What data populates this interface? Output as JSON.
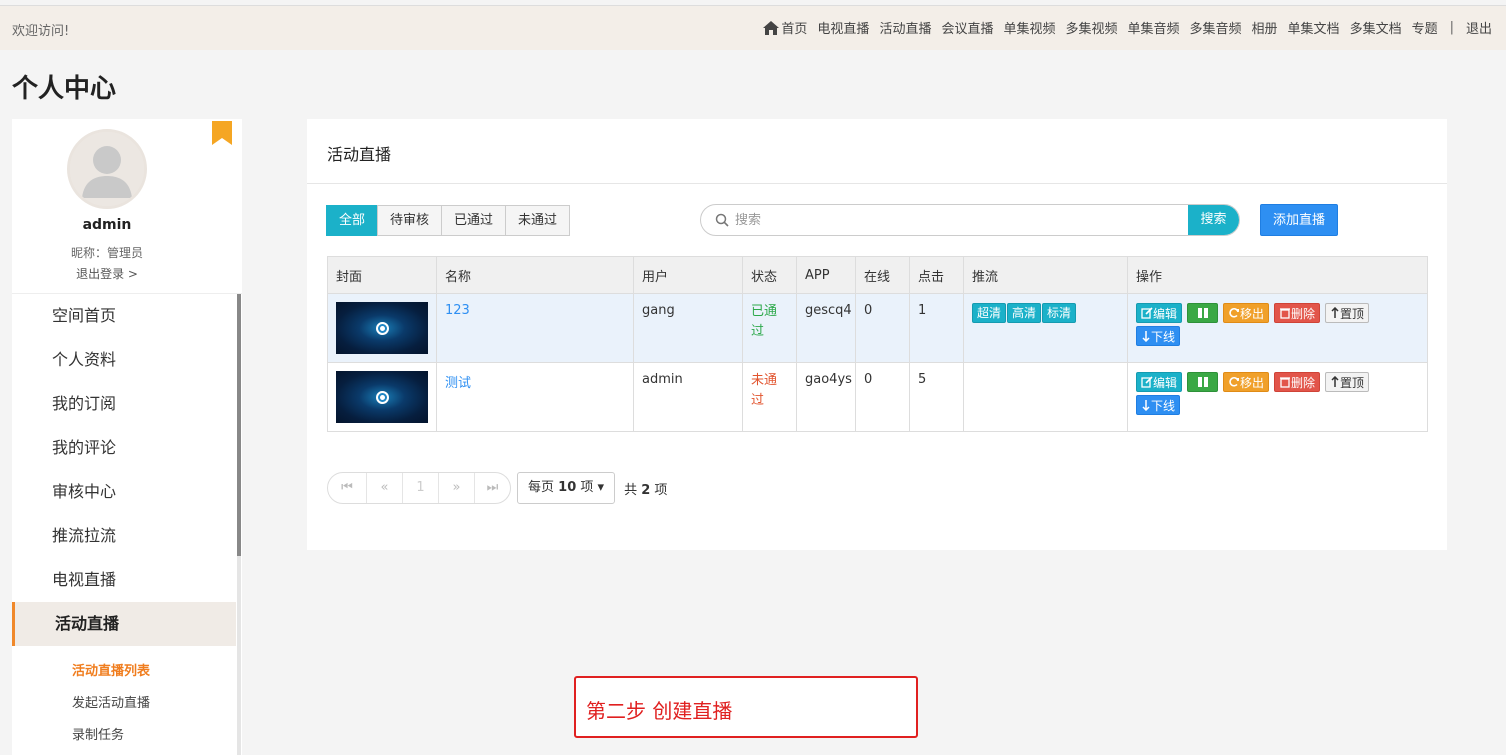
{
  "topbar": {
    "welcome": "欢迎访问!",
    "nav": [
      "首页",
      "电视直播",
      "活动直播",
      "会议直播",
      "单集视频",
      "多集视频",
      "单集音频",
      "多集音频",
      "相册",
      "单集文档",
      "多集文档",
      "专题"
    ],
    "logout": "退出"
  },
  "page_title": "个人中心",
  "profile": {
    "username": "admin",
    "nickname": "昵称：管理员",
    "logout": "退出登录 >"
  },
  "sidebar": {
    "items": [
      "空间首页",
      "个人资料",
      "我的订阅",
      "我的评论",
      "审核中心",
      "推流拉流",
      "电视直播",
      "活动直播"
    ],
    "subitems": [
      "活动直播列表",
      "发起活动直播",
      "录制任务"
    ]
  },
  "card": {
    "title": "活动直播",
    "filters": [
      "全部",
      "待审核",
      "已通过",
      "未通过"
    ],
    "search_placeholder": "搜索",
    "search_button": "搜索",
    "add_button": "添加直播"
  },
  "table": {
    "headers": [
      "封面",
      "名称",
      "用户",
      "状态",
      "APP",
      "在线",
      "点击",
      "推流",
      "操作"
    ],
    "rows": [
      {
        "name": "123",
        "user": "gang",
        "status": "已通过",
        "app": "gescq4",
        "online": "0",
        "clicks": "1",
        "streams": [
          "超清",
          "高清",
          "标清"
        ]
      },
      {
        "name": "测试",
        "user": "admin",
        "status": "未通过",
        "app": "gao4ys",
        "online": "0",
        "clicks": "5",
        "streams": []
      }
    ],
    "ops": {
      "edit": "编辑",
      "move": "移出",
      "delete": "删除",
      "top": "置顶",
      "offline": "下线"
    }
  },
  "pager": {
    "current_page": "1",
    "per_page_prefix": "每页",
    "per_page_value": "10",
    "per_page_suffix": "项",
    "total_prefix": "共",
    "total_value": "2",
    "total_suffix": "项"
  },
  "annotation": "第二步 创建直播",
  "colors": {
    "accent": "#1bb1c9",
    "primary": "#2e8ff2",
    "active_menu": "#f07d1e",
    "annotation": "#e02020"
  }
}
